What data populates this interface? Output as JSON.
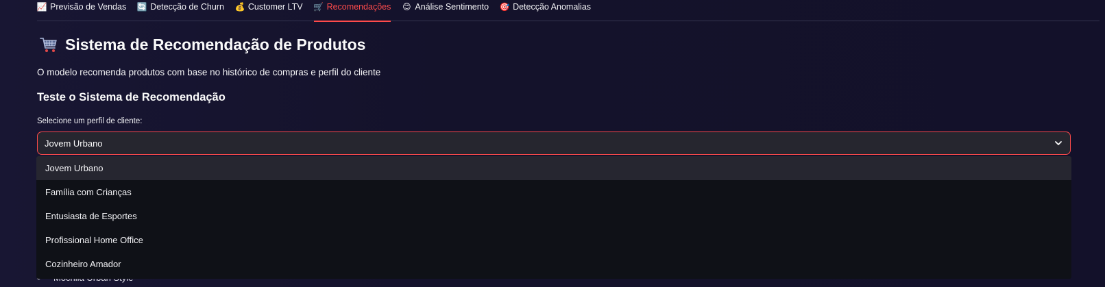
{
  "tabs": [
    {
      "icon": "chart-up-icon",
      "label": "Previsão de Vendas",
      "active": false
    },
    {
      "icon": "refresh-icon",
      "label": "Detecção de Churn",
      "active": false
    },
    {
      "icon": "money-bag-icon",
      "label": "Customer LTV",
      "active": false
    },
    {
      "icon": "cart-icon",
      "label": "Recomendações",
      "active": true
    },
    {
      "icon": "smile-icon",
      "label": "Análise Sentimento",
      "active": false
    },
    {
      "icon": "target-icon",
      "label": "Detecção Anomalias",
      "active": false
    }
  ],
  "tab_icon_glyphs": [
    "📈",
    "🔄",
    "💰",
    "🛒",
    "😊",
    "🎯"
  ],
  "page": {
    "title": "Sistema de Recomendação de Produtos",
    "title_icon": "cart-icon",
    "subtitle": "O modelo recomenda produtos com base no histórico de compras e perfil do cliente",
    "section_title": "Teste o Sistema de Recomendação",
    "select_label": "Selecione um perfil de cliente:"
  },
  "select": {
    "value": "Jovem Urbano",
    "options": [
      "Jovem Urbano",
      "Família com Crianças",
      "Entusiasta de Esportes",
      "Profissional Home Office",
      "Cozinheiro Amador"
    ]
  },
  "partial_list": {
    "item": "Mochila Urban Style"
  },
  "colors": {
    "accent": "#ff4b4b",
    "background": "#14122b",
    "dropdown_bg": "#0f1117",
    "highlight_bg": "#262630"
  }
}
